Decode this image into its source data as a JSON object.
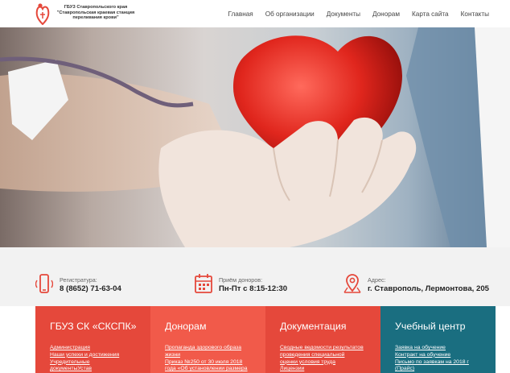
{
  "header": {
    "logo_lines": [
      "ГБУЗ Ставропольского края",
      "\"Ставропольская краевая станция",
      "переливания крови\""
    ],
    "nav": [
      "Главная",
      "Об организации",
      "Документы",
      "Донорам",
      "Карта сайта",
      "Контакты"
    ]
  },
  "info": {
    "items": [
      {
        "label": "Регистратура:",
        "value": "8 (8652) 71-63-04",
        "icon": "phone-icon"
      },
      {
        "label": "Приём доноров:",
        "value": "Пн-Пт с 8:15-12:30",
        "icon": "calendar-icon"
      },
      {
        "label": "Адрес:",
        "value": "г. Ставрополь, Лермонтова, 205",
        "icon": "map-pin-icon"
      }
    ]
  },
  "panels": [
    {
      "title": "ГБУЗ СК «СКСПК»",
      "color": "#e5483b",
      "links": [
        "Администрация",
        "Наши успехи и достижения",
        "Учредительные",
        "документыУстав"
      ]
    },
    {
      "title": "Донорам",
      "color": "#f15a4a",
      "links": [
        "Пропаганда здорового образа",
        "жизни",
        "Приказ №250 от 30 июля 2018",
        "года «Об установлении размера"
      ]
    },
    {
      "title": "Документация",
      "color": "#e5483b",
      "links": [
        "Сводные ведомости результатов",
        "проведения специальной",
        "оценки условия труда",
        "Лицензии"
      ]
    },
    {
      "title": "Учебный центр",
      "color": "#1a6e80",
      "links": [
        "Заявка на обучение",
        "Контракт на обучение",
        "Письмо по заявкам на 2018 г",
        "(Прайс)"
      ]
    }
  ],
  "colors": {
    "accent": "#e5483b",
    "teal": "#1a6e80",
    "info_bg": "#f2f2f2"
  }
}
